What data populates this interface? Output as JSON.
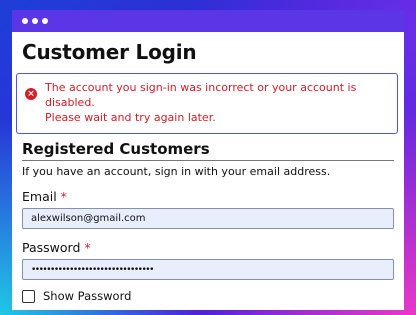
{
  "window": {
    "title_dots": 3
  },
  "page": {
    "title": "Customer Login"
  },
  "alert": {
    "icon": "error-circle-icon",
    "message_line1": "The account you sign-in was incorrect or your account is disabled.",
    "message_line2": "Please wait and try again later.",
    "color": "#cf1d28",
    "border_color": "#4a56e6"
  },
  "section": {
    "title": "Registered Customers",
    "helper": "If you have an account, sign in with your email address."
  },
  "email": {
    "label": "Email",
    "required_mark": "*",
    "value": "alexwilson@gmail.com"
  },
  "password": {
    "label": "Password",
    "required_mark": "*",
    "value": "••••••••••••••••••••••••••••••••"
  },
  "show_password": {
    "label": "Show Password",
    "checked": false
  },
  "colors": {
    "titlebar": "#5b36e6",
    "input_background": "#e8eefc",
    "required": "#d21f2a"
  }
}
